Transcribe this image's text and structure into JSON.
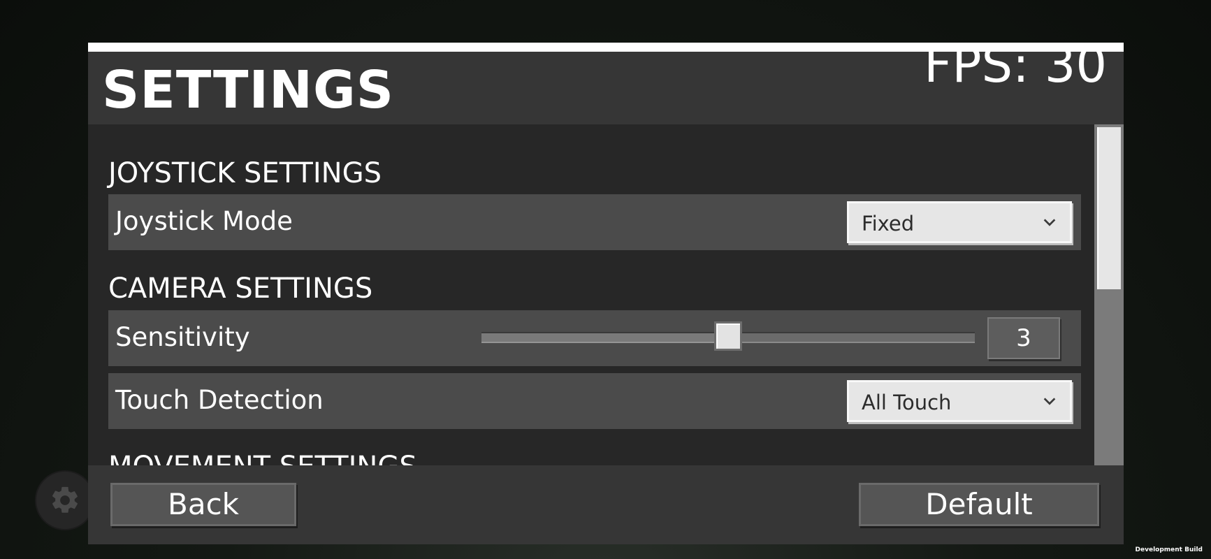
{
  "header": {
    "title": "SETTINGS",
    "fps": "FPS: 30"
  },
  "sections": {
    "joystick": {
      "heading": "JOYSTICK SETTINGS",
      "mode": {
        "label": "Joystick Mode",
        "value": "Fixed"
      }
    },
    "camera": {
      "heading": "CAMERA SETTINGS",
      "sensitivity": {
        "label": "Sensitivity",
        "value": "3",
        "level": 0.5
      },
      "touch": {
        "label": "Touch Detection",
        "value": "All Touch"
      }
    },
    "movement": {
      "heading": "MOVEMENT SETTINGS"
    }
  },
  "footer": {
    "back_label": "Back",
    "default_label": "Default"
  },
  "watermark": "Development Build",
  "icons": {
    "settings_fab": "gear-icon",
    "dropdown_arrow": "chevron-down-icon"
  },
  "colors": {
    "panel": "#2b2b2b",
    "header": "#363636",
    "row": "#4b4b4b",
    "dropdown": "#e6e6e6",
    "text": "#ffffff"
  }
}
